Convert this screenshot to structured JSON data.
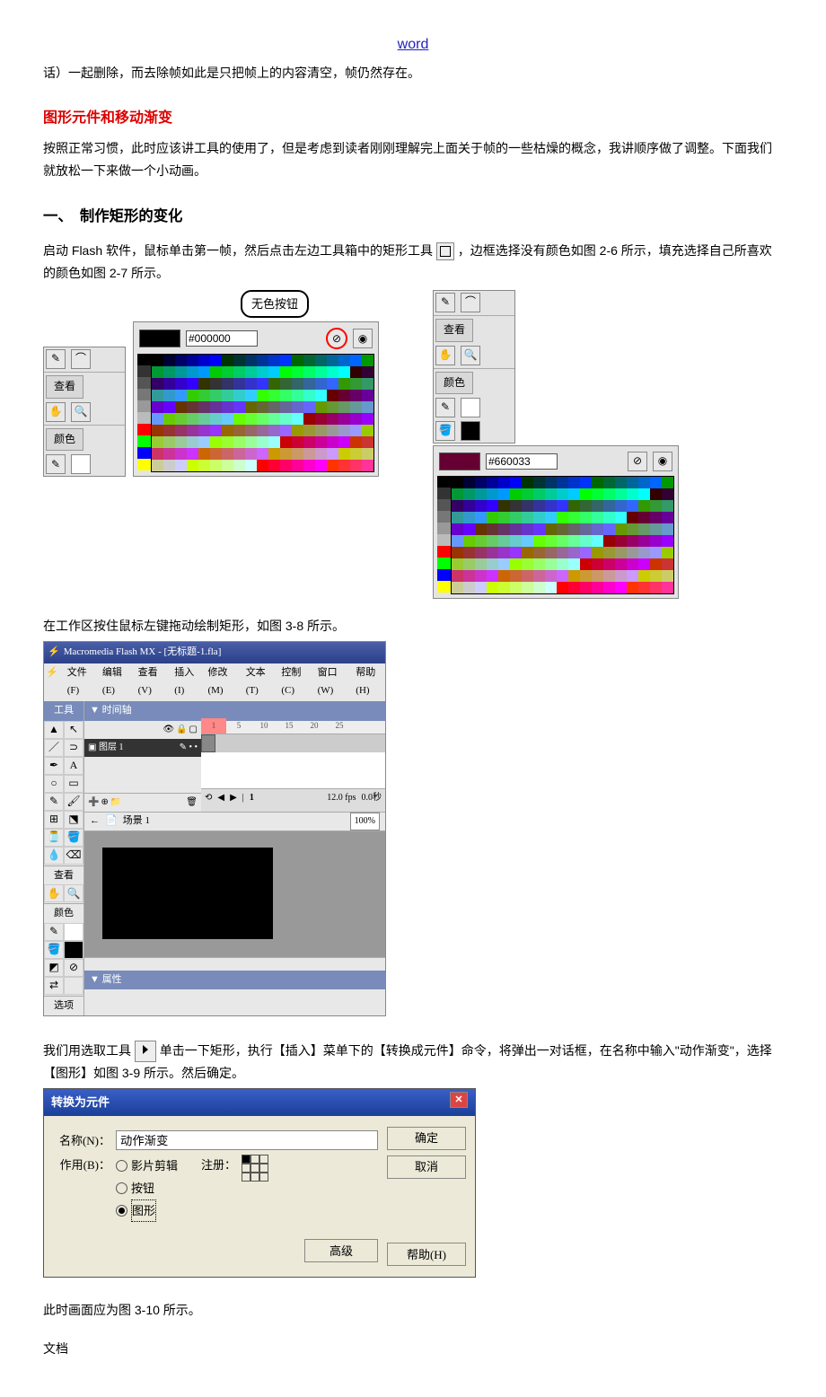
{
  "header_link": "word",
  "para1": "话）一起删除，而去除帧如此是只把帧上的内容清空，帧仍然存在。",
  "h2": "图形元件和移动渐变",
  "para2": "按照正常习惯，此时应该讲工具的使用了，但是考虑到读者刚刚理解完上面关于帧的一些枯燥的概念，我讲顺序做了调整。下面我们就放松一下来做一个小动画。",
  "h3": "一、　制作矩形的变化",
  "para3a": "启动 Flash 软件，鼠标单击第一帧，然后点击左边工具箱中的矩形工具",
  "para3b": "，边框选择没有颜色如图 2-6 所示，填充选择自己所喜欢的颜色如图 2-7 所示。",
  "panel": {
    "view": "查看",
    "color": "颜色",
    "hex1": "#000000",
    "hex2": "#660033",
    "callout": "无色按钮"
  },
  "para4": "在工作区按住鼠标左键拖动绘制矩形，如图 3-8 所示。",
  "flash": {
    "title": "Macromedia Flash MX - [无标题-1.fla]",
    "menu": [
      "文件(F)",
      "编辑(E)",
      "查看(V)",
      "插入(I)",
      "修改(M)",
      "文本(T)",
      "控制(C)",
      "窗口(W)",
      "帮助(H)"
    ],
    "tools_hdr": "工具",
    "timeline_hdr": "▼ 时间轴",
    "layer": "图层 1",
    "ruler": [
      "1",
      "5",
      "10",
      "15",
      "20",
      "25"
    ],
    "scene": "场景 1",
    "fps": "12.0 fps",
    "time": "0.0秒",
    "zoom": "100%",
    "view": "查看",
    "color": "颜色",
    "options": "选项",
    "props": "▼ 属性"
  },
  "para5a": "我们用选取工具",
  "para5b": "单击一下矩形，执行【插入】菜单下的【转换成元件】命令，将弹出一对话框，在名称中输入\"动作渐变\"，选择【图形】如图 3-9 所示。然后确定。",
  "dialog": {
    "title": "转换为元件",
    "name_lbl": "名称(N)：",
    "name_val": "动作渐变",
    "behavior_lbl": "作用(B)：",
    "opt1": "影片剪辑",
    "opt2": "按钮",
    "opt3": "图形",
    "reg_lbl": "注册：",
    "ok": "确定",
    "cancel": "取消",
    "advanced": "高级",
    "help": "帮助(H)"
  },
  "para6": "此时画面应为图 3-10 所示。",
  "footer": "文档"
}
